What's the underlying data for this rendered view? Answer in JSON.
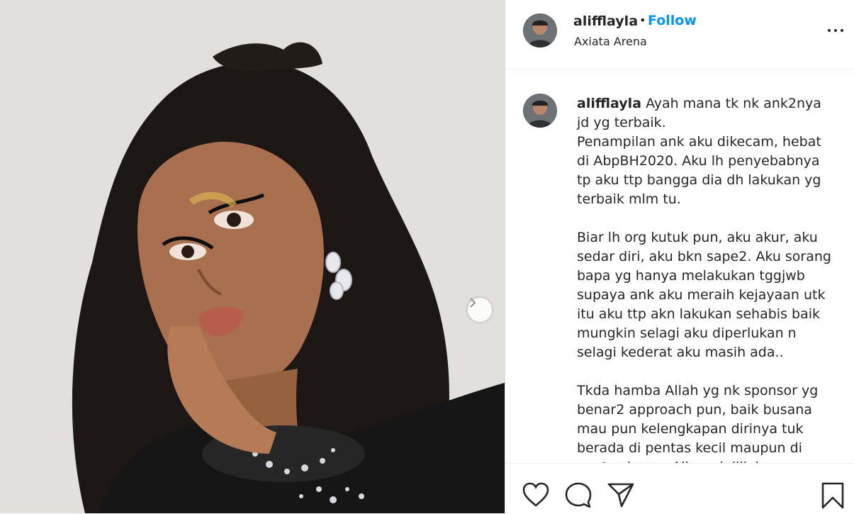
{
  "post": {
    "username": "alifflayla",
    "follow_label": "Follow",
    "location": "Axiata Arena",
    "caption_user": "alifflayla",
    "caption_text": "Ayah mana tk nk ank2nya jd yg terbaik.\nPenampilan ank aku dikecam, hebat di AbpBH2020. Aku lh penyebabnya tp aku ttp bangga dia dh lakukan yg terbaik mlm tu.\n\nBiar lh org kutuk pun, aku akur, aku sedar diri, aku bkn sape2. Aku sorang bapa yg hanya melakukan tggjwb supaya ank aku meraih kejayaan utk itu aku ttp akn lakukan sehabis baik mungkin selagi aku diperlukan n selagi kederat aku masih ada..\n\nTkda hamba Allah yg nk sponsor yg benar2 approach pun, baik busana mau pun kelengkapan dirinya tuk berada di pentas kecil maupun di pentas besar. Alhamdulillah..."
  },
  "icons": {
    "more": "more-options-icon",
    "next": "chevron-right-icon",
    "like": "heart-icon",
    "comment": "comment-icon",
    "share": "paper-plane-icon",
    "save": "bookmark-icon"
  },
  "colors": {
    "follow": "#0095f6",
    "text": "#262626",
    "border": "#efefef"
  }
}
